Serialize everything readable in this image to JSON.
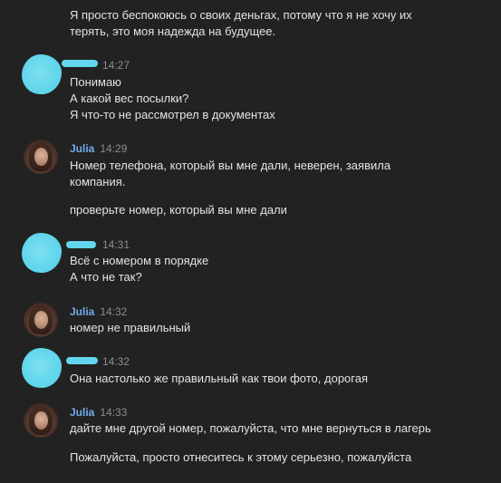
{
  "messages": [
    {
      "author": "",
      "time": "",
      "lines": [
        "Я просто беспокоюсь о своих деньгах, потому что я не хочу их",
        "терять, это моя надежда на будущее."
      ]
    },
    {
      "author": "",
      "time": "14:27",
      "lines": [
        "Понимаю",
        "А какой вес посылки?",
        "Я что-то не рассмотрел в документах"
      ]
    },
    {
      "author": "Julia",
      "time": "14:29",
      "lines": [
        "Номер телефона, который вы мне дали, неверен, заявила",
        "компания."
      ],
      "extra": "проверьте номер, который вы мне дали"
    },
    {
      "author": "",
      "time": "14:31",
      "lines": [
        "Всё с номером в порядке",
        "А что не так?"
      ]
    },
    {
      "author": "Julia",
      "time": "14:32",
      "lines": [
        "номер не правильный"
      ]
    },
    {
      "author": "",
      "time": "14:32",
      "lines": [
        "Она настолько же правильный как твои фото, дорогая"
      ]
    },
    {
      "author": "Julia",
      "time": "14:33",
      "lines": [
        "дайте мне другой номер, пожалуйста, что мне вернуться в лагерь"
      ],
      "extra": "Пожалуйста, просто отнеситесь к этому серьезно, пожалуйста"
    }
  ],
  "colors": {
    "background": "#222222",
    "text": "#e1e3e6",
    "author": "#71aaeb",
    "time": "#8a8d91",
    "redaction": "#62d6ec"
  }
}
